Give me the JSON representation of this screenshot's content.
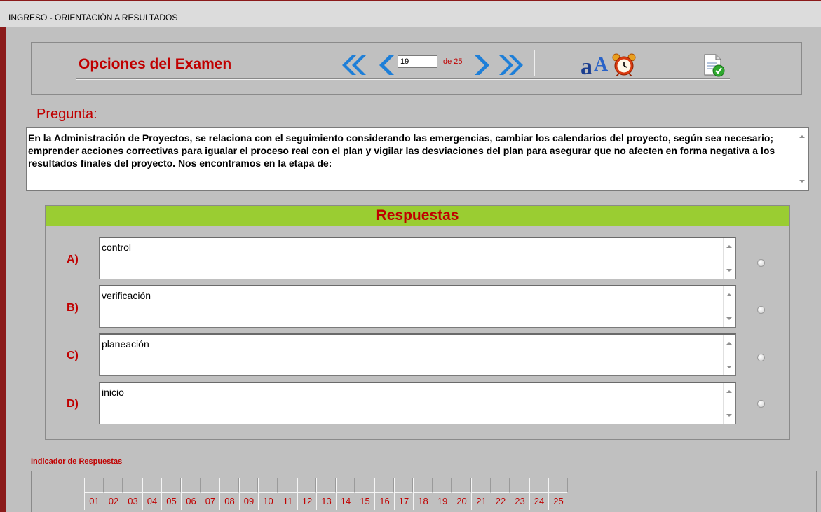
{
  "window": {
    "title": "INGRESO - ORIENTACIÓN A RESULTADOS"
  },
  "toolbar": {
    "title": "Opciones del Examen",
    "current_question": "19",
    "total_label": "de 25",
    "icons": [
      "first-page-icon",
      "previous-page-icon",
      "next-page-icon",
      "last-page-icon",
      "font-size-icon",
      "alarm-clock-icon",
      "finish-exam-icon"
    ]
  },
  "question": {
    "label": "Pregunta:",
    "text": "En la Administración de Proyectos, se relaciona con el seguimiento considerando las emergencias, cambiar los calendarios del proyecto, según sea necesario; emprender acciones correctivas para igualar el proceso real con el plan y vigilar las desviaciones del plan para asegurar que no afecten en forma negativa a los resultados finales del proyecto. Nos encontramos en la etapa de:"
  },
  "answers": {
    "title": "Respuestas",
    "options": [
      {
        "letter": "A)",
        "text": "control",
        "selected": false
      },
      {
        "letter": "B)",
        "text": "verificación",
        "selected": false
      },
      {
        "letter": "C)",
        "text": "planeación",
        "selected": false
      },
      {
        "letter": "D)",
        "text": "inicio",
        "selected": false
      }
    ]
  },
  "indicator": {
    "label": "Indicador de Respuestas",
    "numbers": [
      "01",
      "02",
      "03",
      "04",
      "05",
      "06",
      "07",
      "08",
      "09",
      "10",
      "11",
      "12",
      "13",
      "14",
      "15",
      "16",
      "17",
      "18",
      "19",
      "20",
      "21",
      "22",
      "23",
      "24",
      "25"
    ]
  },
  "colors": {
    "accent_red": "#c00000",
    "header_green": "#9acd32",
    "nav_blue": "#1e7fd8",
    "background": "#c0c0c0"
  }
}
